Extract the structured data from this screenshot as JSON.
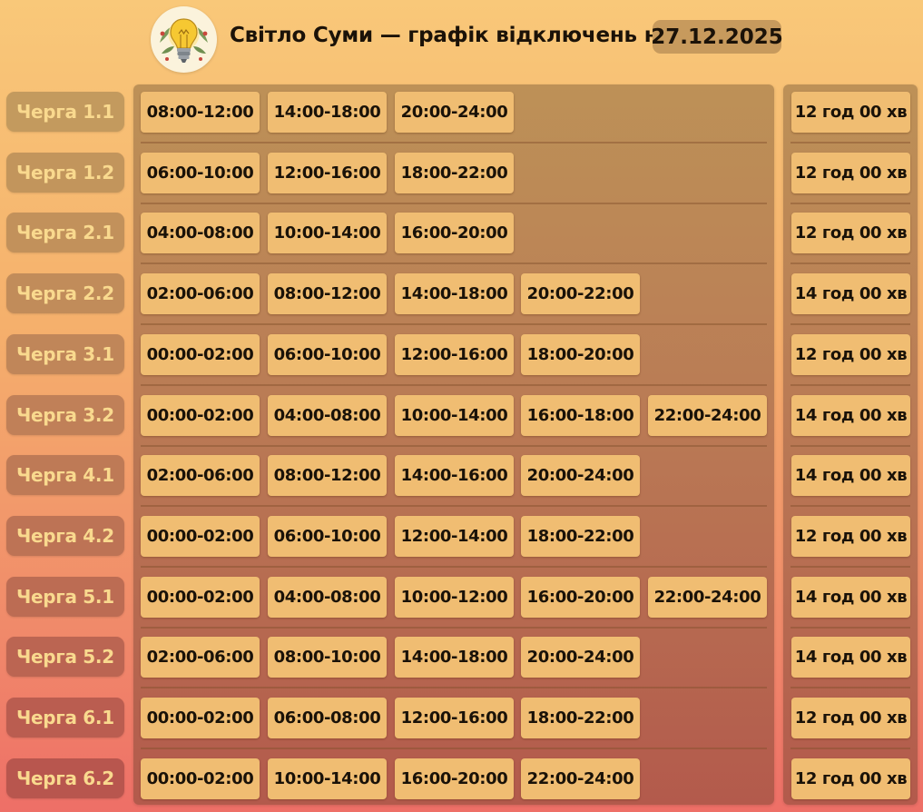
{
  "header": {
    "logo_icon": "lightbulb-icon",
    "title": "Світло Суми — графік відключень на",
    "date": "27.12.2025"
  },
  "colors": {
    "accent_badge": "#c79a5d",
    "slot_background": "#f0bd72",
    "label_text": "#f9d98e"
  },
  "queues": [
    {
      "label": "Черга 1.1",
      "slots": [
        "08:00-12:00",
        "14:00-18:00",
        "20:00-24:00"
      ],
      "total": "12 год 00 хв"
    },
    {
      "label": "Черга 1.2",
      "slots": [
        "06:00-10:00",
        "12:00-16:00",
        "18:00-22:00"
      ],
      "total": "12 год 00 хв"
    },
    {
      "label": "Черга 2.1",
      "slots": [
        "04:00-08:00",
        "10:00-14:00",
        "16:00-20:00"
      ],
      "total": "12 год 00 хв"
    },
    {
      "label": "Черга 2.2",
      "slots": [
        "02:00-06:00",
        "08:00-12:00",
        "14:00-18:00",
        "20:00-22:00"
      ],
      "total": "14 год 00 хв"
    },
    {
      "label": "Черга 3.1",
      "slots": [
        "00:00-02:00",
        "06:00-10:00",
        "12:00-16:00",
        "18:00-20:00"
      ],
      "total": "12 год 00 хв"
    },
    {
      "label": "Черга 3.2",
      "slots": [
        "00:00-02:00",
        "04:00-08:00",
        "10:00-14:00",
        "16:00-18:00",
        "22:00-24:00"
      ],
      "total": "14 год 00 хв"
    },
    {
      "label": "Черга 4.1",
      "slots": [
        "02:00-06:00",
        "08:00-12:00",
        "14:00-16:00",
        "20:00-24:00"
      ],
      "total": "14 год 00 хв"
    },
    {
      "label": "Черга 4.2",
      "slots": [
        "00:00-02:00",
        "06:00-10:00",
        "12:00-14:00",
        "18:00-22:00"
      ],
      "total": "12 год 00 хв"
    },
    {
      "label": "Черга 5.1",
      "slots": [
        "00:00-02:00",
        "04:00-08:00",
        "10:00-12:00",
        "16:00-20:00",
        "22:00-24:00"
      ],
      "total": "14 год 00 хв"
    },
    {
      "label": "Черга 5.2",
      "slots": [
        "02:00-06:00",
        "08:00-10:00",
        "14:00-18:00",
        "20:00-24:00"
      ],
      "total": "14 год 00 хв"
    },
    {
      "label": "Черга 6.1",
      "slots": [
        "00:00-02:00",
        "06:00-08:00",
        "12:00-16:00",
        "18:00-22:00"
      ],
      "total": "12 год 00 хв"
    },
    {
      "label": "Черга 6.2",
      "slots": [
        "00:00-02:00",
        "10:00-14:00",
        "16:00-20:00",
        "22:00-24:00"
      ],
      "total": "12 год 00 хв"
    }
  ]
}
